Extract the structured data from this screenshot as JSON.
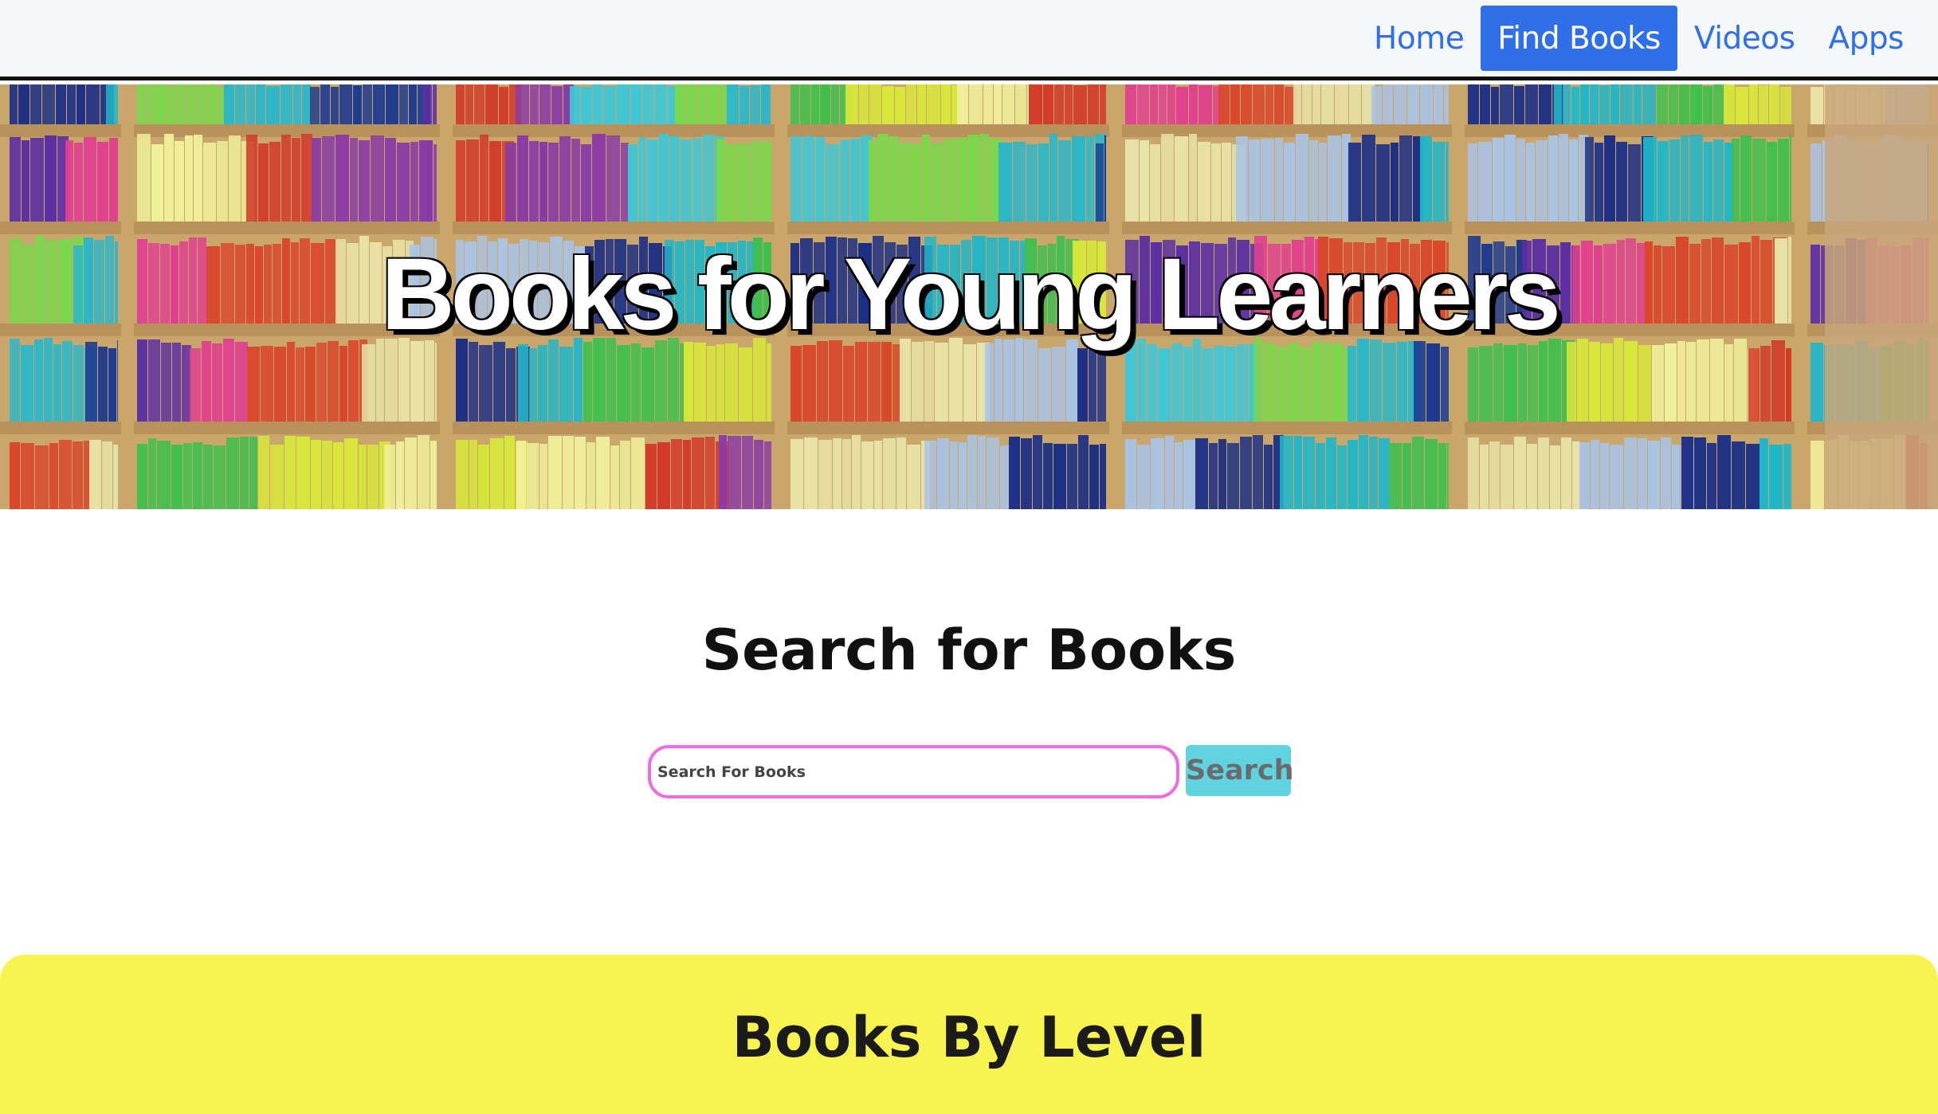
{
  "nav": {
    "items": [
      {
        "label": "Home",
        "active": false
      },
      {
        "label": "Find Books",
        "active": true
      },
      {
        "label": "Videos",
        "active": false
      },
      {
        "label": "Apps",
        "active": false
      }
    ]
  },
  "hero": {
    "title": "Books for Young Learners",
    "image": "bookshelf-with-colorful-books"
  },
  "search": {
    "title": "Search for Books",
    "placeholder": "Search For Books",
    "value": "",
    "button_label": "Search"
  },
  "levels": {
    "title": "Books By Level"
  },
  "colors": {
    "nav_link": "#2f6fe8",
    "nav_active_bg": "#2f6fe8",
    "search_border": "#ee6be3",
    "search_button_bg": "#5fd3e0",
    "level_section_bg": "#f8f44f"
  }
}
